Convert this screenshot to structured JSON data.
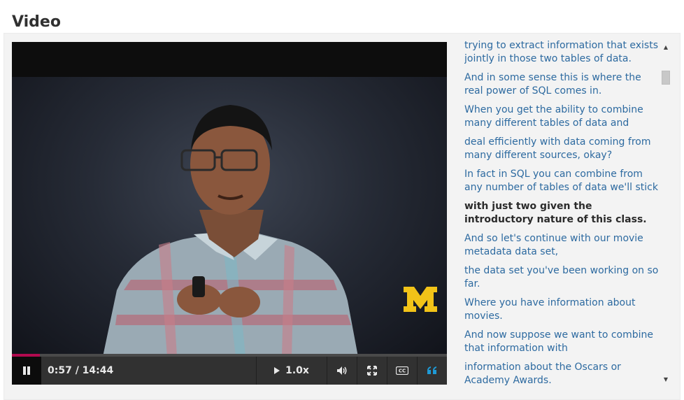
{
  "page": {
    "heading": "Video"
  },
  "player": {
    "time_display": "0:57 / 14:44",
    "progress_fraction": 0.064,
    "speed_label": "1.0x",
    "accent_color": "#b20a4f",
    "icons": {
      "play": "pause-icon",
      "speed": "play-triangle-icon",
      "volume": "volume-icon",
      "fullscreen": "fullscreen-icon",
      "captions": "cc-icon",
      "transcript": "quote-icon"
    }
  },
  "transcript": {
    "link_color": "#2d6aa0",
    "current_index": 5,
    "lines": [
      "trying to extract information that exists jointly in those two tables of data.",
      "And in some sense this is where the real power of SQL comes in.",
      "When you get the ability to combine many different tables of data and",
      "deal efficiently with data coming from many different sources, okay?",
      "In fact in SQL you can combine from any number of tables of data we'll stick",
      "with just two given the introductory nature of this class.",
      "And so let's continue with our movie metadata data set,",
      "the data set you've been working on so far.",
      "Where you have information about movies.",
      "And now suppose we want to combine that information with",
      "information about the Oscars or Academy Awards."
    ]
  }
}
